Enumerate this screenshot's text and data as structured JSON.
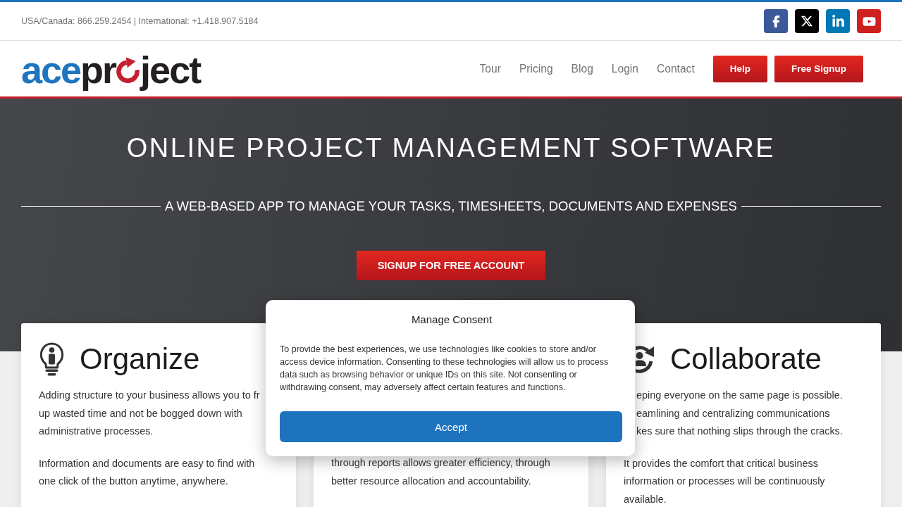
{
  "top_bar": {
    "contact": "USA/Canada: 866.259.2454 | International: +1.418.907.5184",
    "social_links": [
      {
        "kind": "facebook"
      },
      {
        "kind": "x"
      },
      {
        "kind": "linkedin"
      },
      {
        "kind": "youtube"
      }
    ]
  },
  "header": {
    "logo": {
      "prefix": "ace",
      "stem": "pr",
      "suffix": "ject"
    },
    "nav_links": [
      "Tour",
      "Pricing",
      "Blog",
      "Login",
      "Contact"
    ],
    "buttons": [
      "Help",
      "Free Signup"
    ]
  },
  "hero": {
    "title": "ONLINE PROJECT MANAGEMENT SOFTWARE",
    "subtitle": "A WEB-BASED APP TO MANAGE YOUR TASKS, TIMESHEETS, DOCUMENTS AND EXPENSES",
    "cta": "SIGNUP FOR FREE ACCOUNT"
  },
  "feature_cards": [
    {
      "title": "Organize",
      "paragraphs": [
        {
          "lines": [
            "Adding structure to your business allows you to fr",
            "up wasted time and not be bogged down with",
            "administrative processes."
          ]
        },
        {
          "lines": [
            "Information and documents are easy to find with",
            "one click of the button anytime, anywhere."
          ]
        }
      ]
    },
    {
      "paragraphs": [
        {
          "lines": [
            "through reports allows greater efficiency, through",
            "better resource allocation and accountability."
          ]
        }
      ]
    },
    {
      "title": "Collaborate",
      "paragraphs": [
        {
          "lines": [
            "eping everyone on the same page is possible.",
            "eamlining and centralizing communications",
            "kes sure that nothing slips through the cracks."
          ]
        },
        {
          "lines": [
            "It provides the comfort that critical business",
            "information or processes will be continuously",
            "available."
          ]
        }
      ]
    }
  ],
  "consent_dialog": {
    "title": "Manage Consent",
    "body": "To provide the best experiences, we use technologies like cookies to store and/or access device information. Consenting to these technologies will allow us to process data such as browsing behavior or unique IDs on this site. Not consenting or withdrawing consent, may adversely affect certain features and functions.",
    "button": "Accept"
  }
}
